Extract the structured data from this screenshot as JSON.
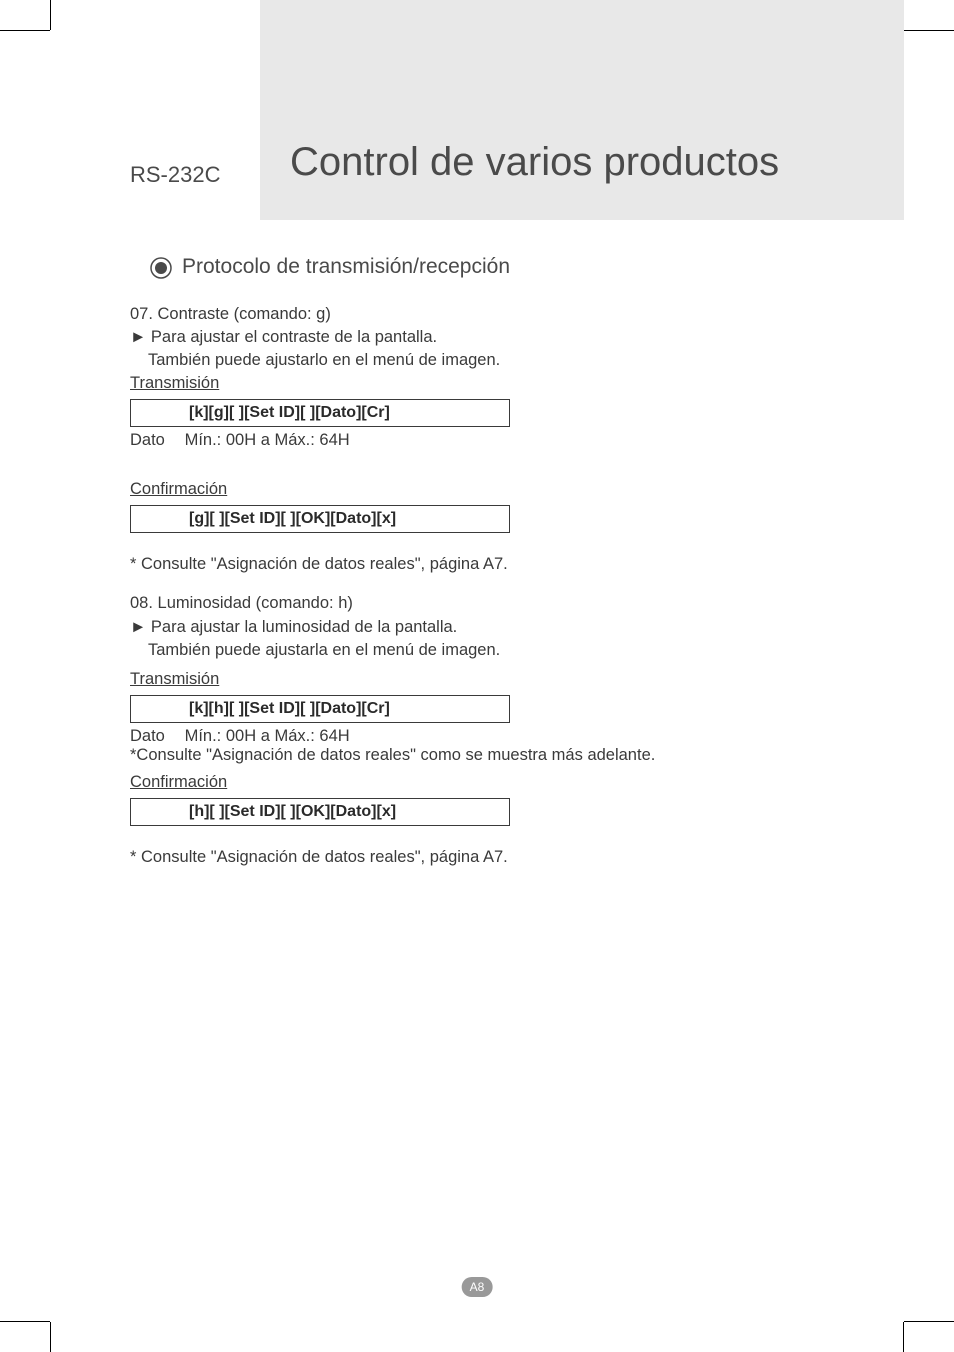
{
  "header": {
    "label": "RS-232C",
    "title": "Control de varios productos"
  },
  "section": {
    "title": "Protocolo de transmisión/recepción"
  },
  "cmd07": {
    "heading": "07. Contraste (comando: g)",
    "desc1": "► Para ajustar el contraste de la pantalla.",
    "desc2": "También puede ajustarlo en el menú de imagen.",
    "trans_label": "Transmisión",
    "trans_code": "[k][g][ ][Set ID][ ][Dato][Cr]",
    "dato_label": "Dato",
    "dato_value": "Mín.: 00H a Máx.: 64H",
    "conf_label": "Confirmación",
    "conf_code": "[g][ ][Set ID][ ][OK][Dato][x]",
    "note": "* Consulte \"Asignación de datos reales\", página A7."
  },
  "cmd08": {
    "heading": "08. Luminosidad (comando: h)",
    "desc1": "► Para ajustar la luminosidad de la pantalla.",
    "desc2": "También puede ajustarla en el menú de imagen.",
    "trans_label": "Transmisión",
    "trans_code": "[k][h][ ][Set ID][ ][Dato][Cr]",
    "dato_label": "Dato",
    "dato_value": "Mín.: 00H a Máx.: 64H",
    "note_inline": "*Consulte \"Asignación de datos reales\" como se muestra más adelante.",
    "conf_label": "Confirmación",
    "conf_code": "[h][ ][Set ID][ ][OK][Dato][x]",
    "note": "* Consulte \"Asignación de datos reales\", página A7."
  },
  "page_number": "A8"
}
